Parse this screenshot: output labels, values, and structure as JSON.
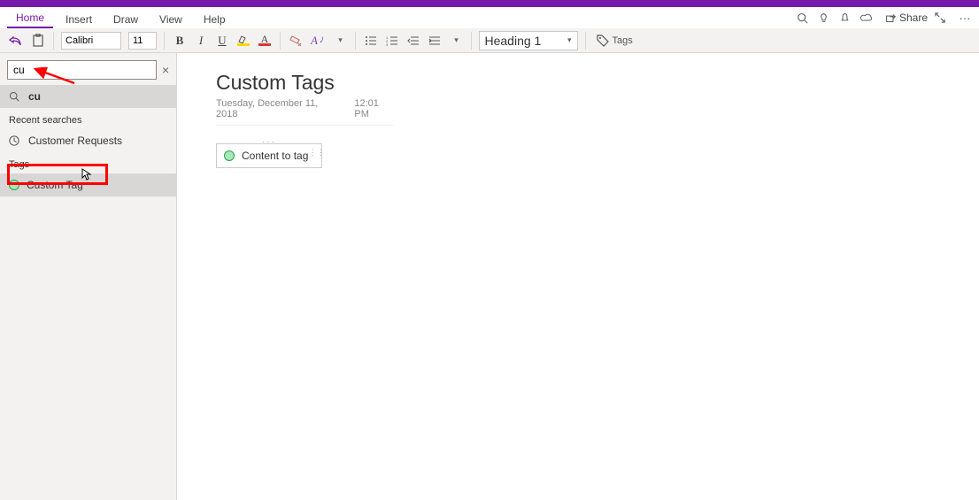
{
  "tabs": {
    "home": "Home",
    "insert": "Insert",
    "draw": "Draw",
    "view": "View",
    "help": "Help"
  },
  "titlebar": {
    "share": "Share"
  },
  "ribbon": {
    "font_name": "Calibri",
    "font_size": "11",
    "style": "Heading 1",
    "tags_label": "Tags"
  },
  "search": {
    "query": "cu",
    "close_title": "Close",
    "result_label": "cu",
    "recent_header": "Recent searches",
    "recent_items": [
      "Customer Requests"
    ],
    "tags_header": "Tags",
    "tag_items": [
      "Custom Tag"
    ]
  },
  "page": {
    "title": "Custom Tags",
    "date": "Tuesday, December 11, 2018",
    "time": "12:01 PM",
    "content": "Content to tag"
  }
}
